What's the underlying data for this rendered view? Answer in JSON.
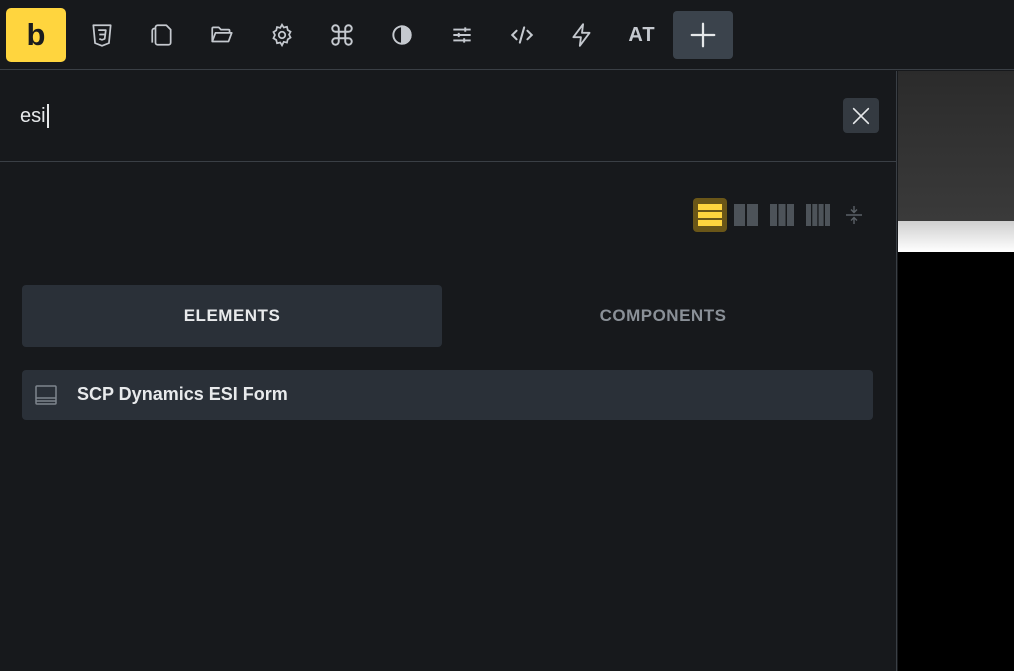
{
  "toolbar": {
    "logo_letter": "b",
    "buttons": [
      {
        "name": "css-icon"
      },
      {
        "name": "pages-icon"
      },
      {
        "name": "folder-open-icon"
      },
      {
        "name": "gear-icon"
      },
      {
        "name": "command-icon"
      },
      {
        "name": "contrast-icon"
      },
      {
        "name": "sliders-icon"
      },
      {
        "name": "code-icon"
      },
      {
        "name": "lightning-icon"
      }
    ],
    "text_button": "AT",
    "add_icon": "plus-icon"
  },
  "search": {
    "value": "esi",
    "placeholder": ""
  },
  "layout_options": [
    "one-column",
    "two-columns",
    "three-columns",
    "four-columns",
    "collapse"
  ],
  "active_layout": "one-column",
  "tabs": [
    {
      "label": "ELEMENTS",
      "active": true
    },
    {
      "label": "COMPONENTS",
      "active": false
    }
  ],
  "results": [
    {
      "label": "SCP Dynamics ESI Form",
      "icon": "form-icon"
    }
  ],
  "colors": {
    "accent": "#ffd53e",
    "background": "#17191c",
    "surface": "#2a3038",
    "text": "#e8eaec",
    "muted": "#8a9097"
  }
}
